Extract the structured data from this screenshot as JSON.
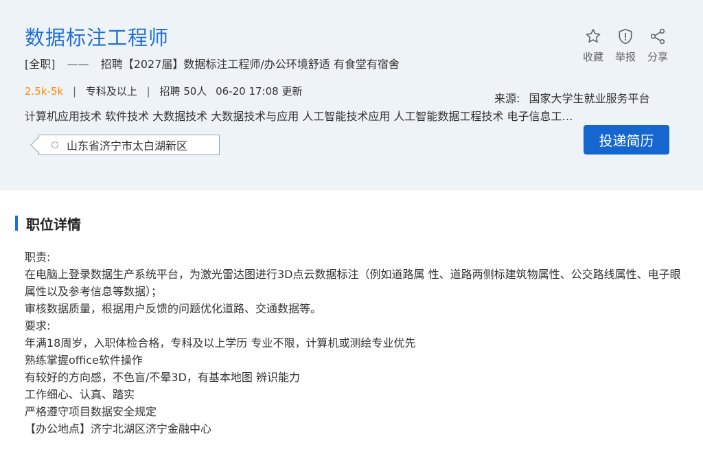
{
  "job": {
    "title": "数据标注工程师",
    "type": "[全职]",
    "dash": "——",
    "headline": "招聘【2027届】数据标注工程师/办公环境舒适 有食堂有宿舍",
    "salary": "2.5k-5k",
    "education": "专科及以上",
    "hiring": "招聘 50人",
    "updated": "06-20 17:08 更新",
    "majors": "计算机应用技术 软件技术 大数据技术 大数据技术与应用 人工智能技术应用 人工智能数据工程技术 电子信息工程技术",
    "location": "山东省济宁市太白湖新区"
  },
  "actions": {
    "favorite": {
      "label": "收藏",
      "icon": "star-icon"
    },
    "report": {
      "label": "举报",
      "icon": "shield-alert-icon"
    },
    "share": {
      "label": "分享",
      "icon": "share-icon"
    }
  },
  "source": {
    "label": "来源:",
    "name": "国家大学生就业服务平台"
  },
  "apply_button": "投递简历",
  "details": {
    "section_title": "职位详情",
    "lines": [
      "职责:",
      "在电脑上登录数据生产系统平台，为激光雷达图进行3D点云数据标注（例如道路属 性、道路两侧标建筑物属性、公交路线属性、电子眼属性以及参考信息等数据）；",
      "审核数据质量，根据用户反馈的问题优化道路、交通数据等。",
      "要求:",
      "年满18周岁，入职体检合格，专科及以上学历 专业不限，计算机或测绘专业优先",
      "熟练掌握office软件操作",
      "有较好的方向感，不色盲/不晕3D，有基本地图 辨识能力",
      "工作细心、认真、踏实",
      "严格遵守项目数据安全规定",
      "【办公地点】济宁北湖区济宁金融中心"
    ]
  },
  "colors": {
    "accent": "#1f6fd6",
    "button": "#1567cf",
    "salary": "#ff8a00",
    "header_bg": "#eef3f8"
  }
}
